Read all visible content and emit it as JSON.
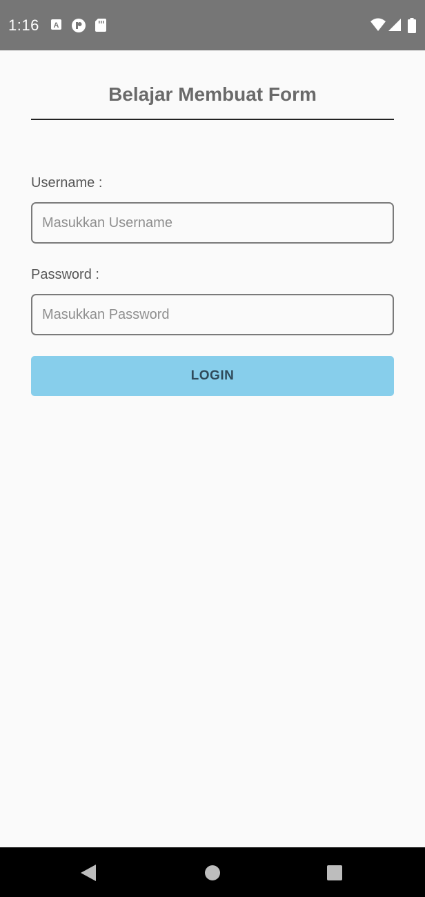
{
  "status_bar": {
    "time": "1:16",
    "icons": [
      "a-icon",
      "p-icon",
      "sd-card-icon",
      "wifi-icon",
      "signal-icon",
      "battery-icon"
    ]
  },
  "form": {
    "title": "Belajar Membuat Form",
    "username_label": "Username :",
    "username_placeholder": "Masukkan Username",
    "password_label": "Password :",
    "password_placeholder": "Masukkan Password",
    "login_label": "LOGIN"
  },
  "colors": {
    "status_bar": "#767676",
    "background": "#fafafa",
    "button": "#87ceeb",
    "button_text": "#2f4a5a",
    "nav_bar": "#000000"
  },
  "nav_bar": {
    "icons": [
      "back-icon",
      "home-icon",
      "recents-icon"
    ]
  }
}
